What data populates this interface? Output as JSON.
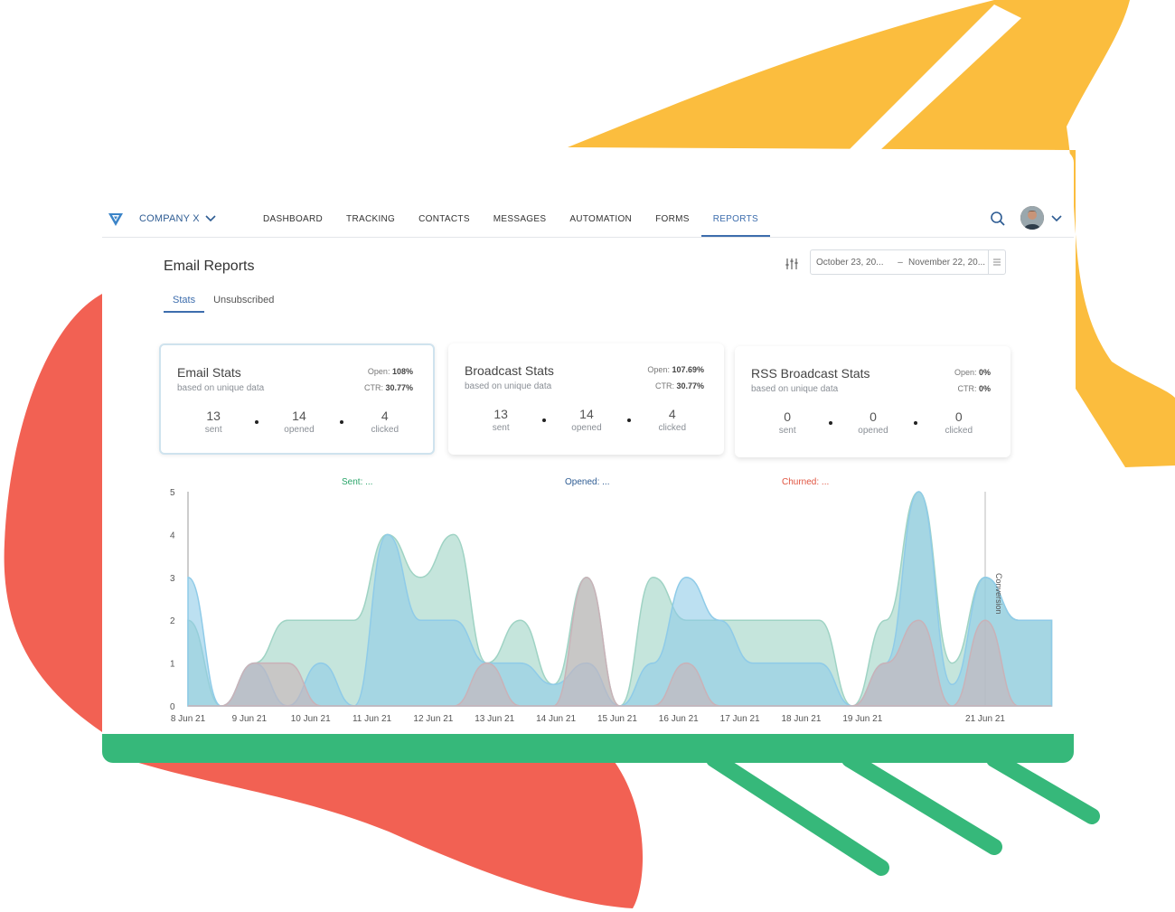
{
  "colors": {
    "yellow": "#fbbd3e",
    "red": "#f26153",
    "green": "#36b87a",
    "accent": "#3d6dad",
    "dot1": "#8a48ad",
    "dot2": "#dcdcea",
    "dot3": "#dcdcea"
  },
  "nav": {
    "company": "COMPANY X",
    "items": [
      {
        "label": "DASHBOARD",
        "active": false
      },
      {
        "label": "TRACKING",
        "active": false
      },
      {
        "label": "CONTACTS",
        "active": false
      },
      {
        "label": "MESSAGES",
        "active": false
      },
      {
        "label": "AUTOMATION",
        "active": false
      },
      {
        "label": "FORMS",
        "active": false
      },
      {
        "label": "REPORTS",
        "active": true
      }
    ]
  },
  "page": {
    "title": "Email Reports",
    "tabs": [
      {
        "label": "Stats",
        "active": true
      },
      {
        "label": "Unsubscribed",
        "active": false
      }
    ],
    "date_from": "October 23, 20...",
    "date_sep": "–",
    "date_to": "November 22, 20..."
  },
  "cards": [
    {
      "title": "Email Stats",
      "subtitle": "based on unique data",
      "open_label": "Open:",
      "open_value": "108%",
      "ctr_label": "CTR:",
      "ctr_value": "30.77%",
      "sent": "13",
      "sent_label": "sent",
      "opened": "14",
      "opened_label": "opened",
      "clicked": "4",
      "clicked_label": "clicked",
      "selected": true
    },
    {
      "title": "Broadcast Stats",
      "subtitle": "based on unique data",
      "open_label": "Open:",
      "open_value": "107.69%",
      "ctr_label": "CTR:",
      "ctr_value": "30.77%",
      "sent": "13",
      "sent_label": "sent",
      "opened": "14",
      "opened_label": "opened",
      "clicked": "4",
      "clicked_label": "clicked",
      "selected": false
    },
    {
      "title": "RSS Broadcast Stats",
      "subtitle": "based on unique data",
      "open_label": "Open:",
      "open_value": "0%",
      "ctr_label": "CTR:",
      "ctr_value": "0%",
      "sent": "0",
      "sent_label": "sent",
      "opened": "0",
      "opened_label": "opened",
      "clicked": "0",
      "clicked_label": "clicked",
      "selected": false
    }
  ],
  "chart_data": {
    "type": "area",
    "categories": [
      "8 Jun 21",
      "9 Jun 21",
      "10 Jun 21",
      "11 Jun 21",
      "12 Jun 21",
      "13 Jun 21",
      "14 Jun 21",
      "15 Jun 21",
      "16 Jun 21",
      "17 Jun 21",
      "18 Jun 21",
      "19 Jun 21",
      "21 Jun 21"
    ],
    "ylim": [
      0,
      5
    ],
    "yticks": [
      "0",
      "1",
      "2",
      "3",
      "4",
      "5"
    ],
    "y2label": "Conversion",
    "legend": [
      {
        "label": "Sent: ...",
        "color": "#2aa56a"
      },
      {
        "label": "Opened: ...",
        "color": "#2e5c93"
      },
      {
        "label": "Churned: ...",
        "color": "#e0533f"
      }
    ],
    "series": [
      {
        "name": "Sent",
        "color": "#9fd3c4",
        "x": [
          0,
          0.5,
          1,
          1.5,
          2,
          2.5,
          3,
          3.5,
          4,
          4.5,
          5,
          5.5,
          6,
          6.5,
          7,
          7.5,
          8,
          8.5,
          9,
          9.5,
          10,
          10.5,
          11,
          11.5,
          12,
          12.5,
          13
        ],
        "values": [
          2,
          0,
          1,
          2,
          2,
          2,
          4,
          3,
          4,
          1,
          2,
          0.5,
          3,
          0,
          3,
          2,
          2,
          2,
          2,
          2,
          0,
          2,
          5,
          1,
          3,
          2,
          2
        ]
      },
      {
        "name": "Opened",
        "color": "#8fcbe8",
        "x": [
          0,
          0.5,
          1,
          1.5,
          2,
          2.5,
          3,
          3.5,
          4,
          4.5,
          5,
          5.5,
          6,
          6.5,
          7,
          7.5,
          8,
          8.5,
          9,
          9.5,
          10,
          10.5,
          11,
          11.5,
          12,
          12.5,
          13
        ],
        "values": [
          3,
          0,
          1,
          0,
          1,
          0,
          4,
          2,
          2,
          1,
          1,
          0.5,
          1,
          0,
          1,
          3,
          2,
          1,
          1,
          1,
          0,
          1,
          5,
          0.5,
          3,
          2,
          2
        ]
      },
      {
        "name": "Churned",
        "color": "#c9b2b8",
        "x": [
          0,
          0.5,
          1,
          1.5,
          2,
          2.5,
          3,
          3.5,
          4,
          4.5,
          5,
          5.5,
          6,
          6.5,
          7,
          7.5,
          8,
          8.5,
          9,
          9.5,
          10,
          10.5,
          11,
          11.5,
          12,
          12.5,
          13
        ],
        "values": [
          0,
          0,
          1,
          1,
          0,
          0,
          0,
          0,
          0,
          1,
          0,
          0,
          3,
          0,
          0,
          1,
          0,
          0,
          0,
          0,
          0,
          1,
          2,
          0,
          2,
          0,
          0
        ]
      }
    ]
  }
}
